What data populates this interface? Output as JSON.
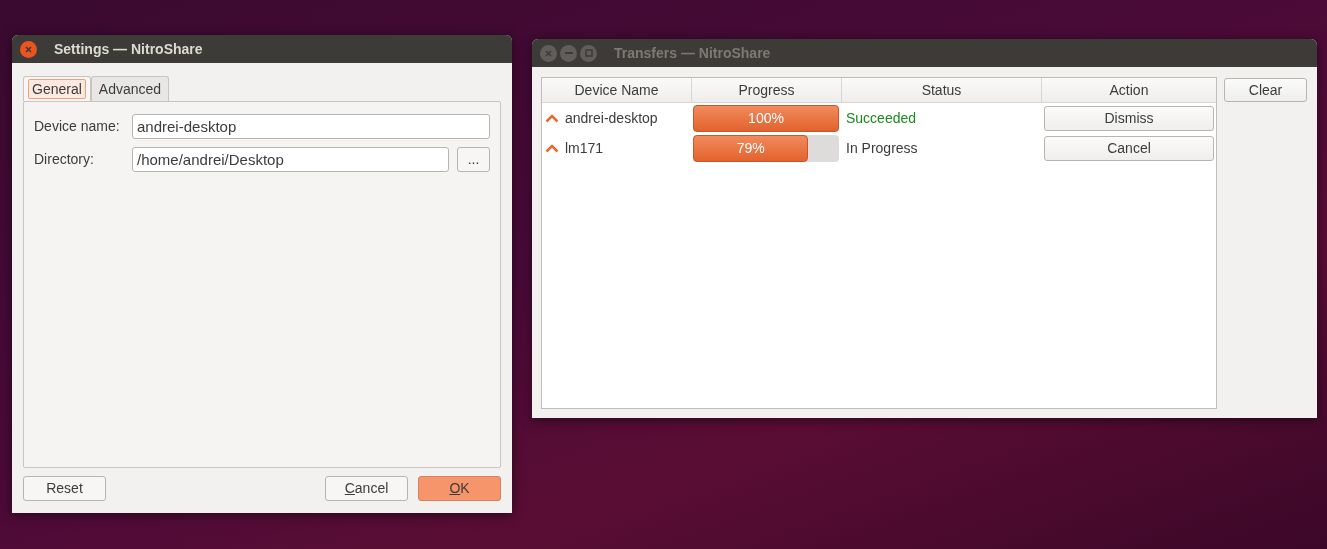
{
  "settings_window": {
    "title": "Settings — NitroShare",
    "focused": true,
    "tabs": [
      {
        "label": "General",
        "selected": true
      },
      {
        "label": "Advanced",
        "selected": false
      }
    ],
    "fields": [
      {
        "label": "Device name:",
        "value": "andrei-desktop"
      },
      {
        "label": "Directory:",
        "value": "/home/andrei/Desktop",
        "browse_button": "..."
      }
    ],
    "buttons": [
      {
        "label": "Reset",
        "default": false,
        "mnemonic": false
      },
      {
        "label": "Cancel",
        "default": false,
        "mnemonic": true
      },
      {
        "label": "OK",
        "default": true,
        "mnemonic": true
      }
    ]
  },
  "transfers_window": {
    "title": "Transfers — NitroShare",
    "focused": false,
    "table": {
      "columns": [
        "Device Name",
        "Progress",
        "Status",
        "Action"
      ],
      "rows": [
        {
          "device": "andrei-desktop",
          "level": 1.0,
          "progress": "100%",
          "status": "Succeeded",
          "kind": "succeeded",
          "action": "Dismiss"
        },
        {
          "device": "lm171",
          "level": 0.79,
          "progress": "79%",
          "status": "In Progress",
          "kind": "in_progress",
          "action": "Cancel"
        }
      ]
    },
    "clear_button": "Clear"
  }
}
